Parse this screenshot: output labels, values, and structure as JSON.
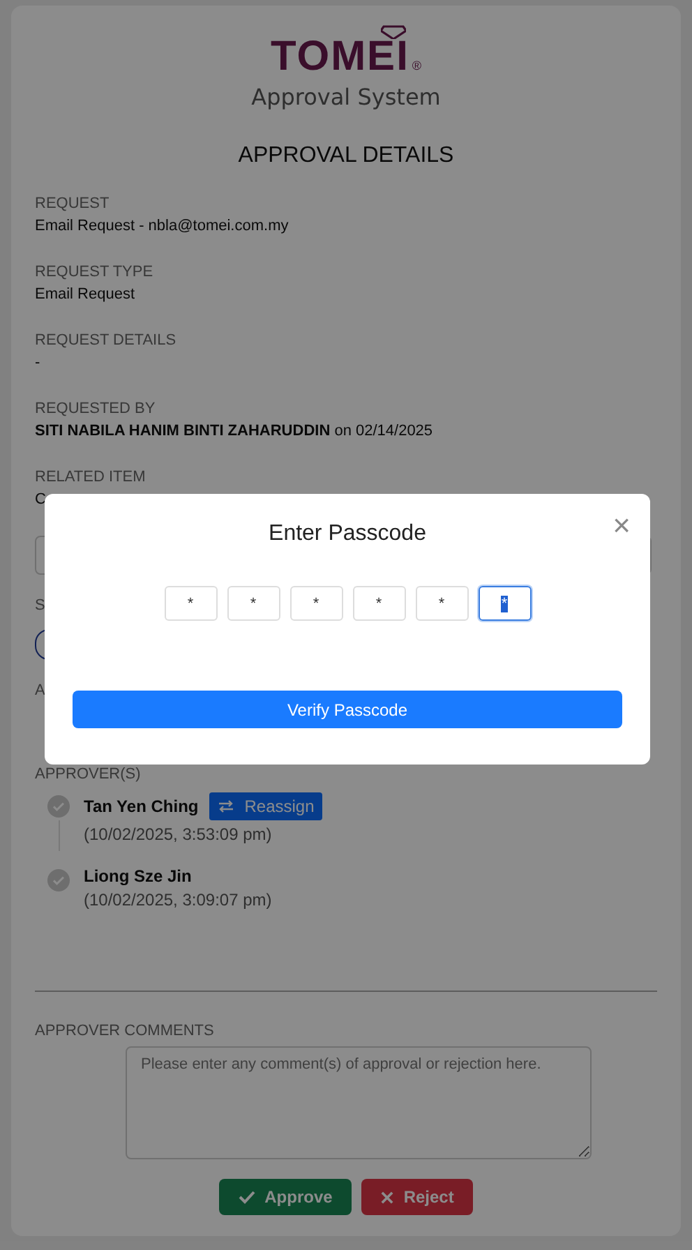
{
  "logo": {
    "brand": "TOMEI",
    "mark": "®",
    "subtitle": "Approval System"
  },
  "title": "APPROVAL DETAILS",
  "fields": [
    {
      "label": "REQUEST",
      "value": "Email Request - nbla@tomei.com.my"
    },
    {
      "label": "REQUEST TYPE",
      "value": "Email Request"
    },
    {
      "label": "REQUEST DETAILS",
      "value": "-"
    },
    {
      "label": "REQUESTED BY",
      "value": "**SITI NABILA HANIM BINTI ZAHARUDDIN** on 02/14/2025"
    },
    {
      "label": "RELATED ITEM",
      "value": "C"
    }
  ],
  "hidden_labels": [
    "S",
    "A"
  ],
  "approvers_label": "APPROVER(S)",
  "approvers": [
    {
      "name": "Tan Yen Ching",
      "time": "(10/02/2025, 3:53:09 pm)",
      "action": "Reassign"
    },
    {
      "name": "Liong Sze Jin",
      "time": "(10/02/2025, 3:09:07 pm)"
    }
  ],
  "comments": {
    "label": "APPROVER COMMENTS",
    "placeholder": "Please enter any comment(s) of approval or rejection here."
  },
  "buttons": [
    {
      "kind": "approve",
      "label": "Approve"
    },
    {
      "kind": "reject",
      "label": "Reject"
    }
  ],
  "modal": {
    "title": "Enter Passcode",
    "close": "×",
    "digits": [
      {
        "value": "*",
        "focused": false
      },
      {
        "value": "*",
        "focused": false
      },
      {
        "value": "*",
        "focused": false
      },
      {
        "value": "*",
        "focused": false
      },
      {
        "value": "*",
        "focused": false
      },
      {
        "value": "*",
        "focused": true
      }
    ],
    "button": "Verify Passcode"
  }
}
